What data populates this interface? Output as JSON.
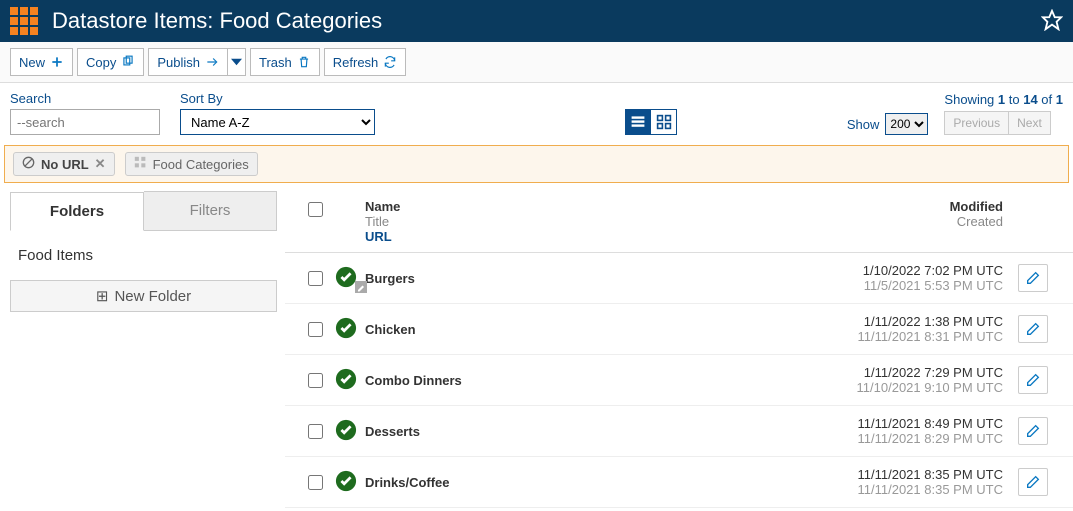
{
  "header": {
    "title": "Datastore Items: Food Categories"
  },
  "toolbar": {
    "new_label": "New",
    "copy_label": "Copy",
    "publish_label": "Publish",
    "trash_label": "Trash",
    "refresh_label": "Refresh"
  },
  "controls": {
    "search_label": "Search",
    "search_placeholder": "--search",
    "sort_label": "Sort By",
    "sort_value": "Name A-Z",
    "show_label": "Show",
    "show_value": "200",
    "showing_prefix": "Showing ",
    "showing_from": "1",
    "showing_mid": " to ",
    "showing_to": "14",
    "showing_suffix": " of ",
    "showing_total": "1",
    "prev_label": "Previous",
    "next_label": "Next"
  },
  "crumbs": {
    "no_url": "No URL",
    "category": "Food Categories"
  },
  "sidebar": {
    "tab_folders": "Folders",
    "tab_filters": "Filters",
    "folder_item": "Food Items",
    "new_folder": "New Folder"
  },
  "table": {
    "head_name": "Name",
    "head_title": "Title",
    "head_url": "URL",
    "head_modified": "Modified",
    "head_created": "Created"
  },
  "rows": [
    {
      "name": "Burgers",
      "modified": "1/10/2022 7:02 PM UTC",
      "created": "11/5/2021 5:53 PM UTC",
      "draft": true
    },
    {
      "name": "Chicken",
      "modified": "1/11/2022 1:38 PM UTC",
      "created": "11/11/2021 8:31 PM UTC",
      "draft": false
    },
    {
      "name": "Combo Dinners",
      "modified": "1/11/2022 7:29 PM UTC",
      "created": "11/10/2021 9:10 PM UTC",
      "draft": false
    },
    {
      "name": "Desserts",
      "modified": "11/11/2021 8:49 PM UTC",
      "created": "11/11/2021 8:29 PM UTC",
      "draft": false
    },
    {
      "name": "Drinks/Coffee",
      "modified": "11/11/2021 8:35 PM UTC",
      "created": "11/11/2021 8:35 PM UTC",
      "draft": false
    }
  ]
}
